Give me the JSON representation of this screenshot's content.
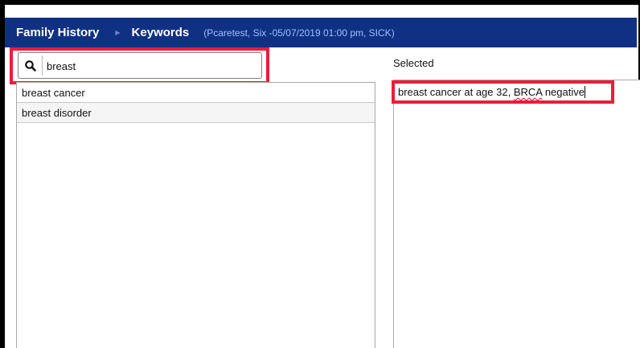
{
  "header": {
    "breadcrumb_1": "Family History",
    "breadcrumb_2": "Keywords",
    "context": "(Pcaretest, Six -05/07/2019 01:00 pm, SICK)"
  },
  "search": {
    "value": "breast",
    "icon": "search-icon"
  },
  "results": {
    "items": [
      {
        "label": "breast cancer"
      },
      {
        "label": "breast disorder"
      }
    ]
  },
  "selected": {
    "label": "Selected",
    "text_prefix": "breast cancer at age 32, ",
    "text_flagged": "BRCA",
    "text_suffix": " negative"
  },
  "colors": {
    "header_bg": "#103083",
    "highlight": "#ed1c3a",
    "context_text": "#9bc1ff"
  }
}
